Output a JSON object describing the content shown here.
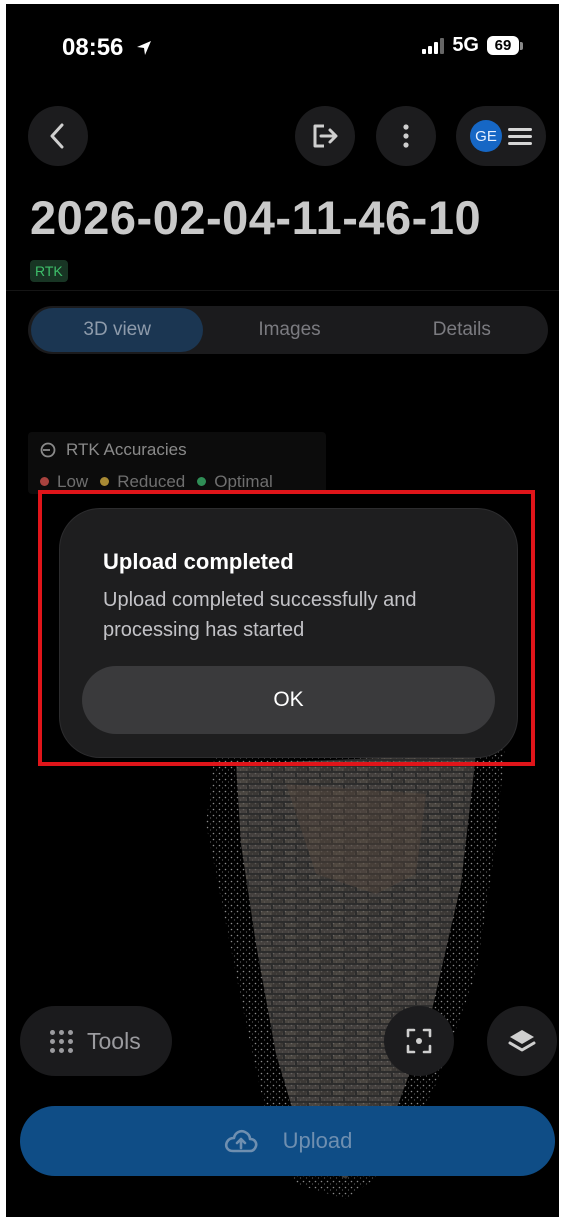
{
  "status_bar": {
    "time": "08:56",
    "network": "5G",
    "battery": "69"
  },
  "header": {
    "avatar_initials": "GE",
    "title": "2026-02-04-11-46-10",
    "badge": "RTK"
  },
  "tabs": [
    {
      "label": "3D view",
      "active": true
    },
    {
      "label": "Images",
      "active": false
    },
    {
      "label": "Details",
      "active": false
    }
  ],
  "legend": {
    "title": "RTK Accuracies",
    "items": [
      {
        "label": "Low",
        "color": "#c94a45"
      },
      {
        "label": "Reduced",
        "color": "#c9a23a"
      },
      {
        "label": "Optimal",
        "color": "#3cae68"
      }
    ]
  },
  "dialog": {
    "title": "Upload completed",
    "message": "Upload completed successfully and processing has started",
    "ok_label": "OK"
  },
  "bottom": {
    "tools_label": "Tools",
    "upload_label": "Upload"
  },
  "colors": {
    "accent": "#0f4d86",
    "highlight": "#e0151a",
    "rtk_green": "#3ebf6a"
  },
  "icons": {
    "back": "chevron-left-icon",
    "export": "export-icon",
    "more": "more-vertical-icon",
    "menu": "hamburger-icon",
    "legend": "rtk-accuracy-icon",
    "tools": "grid-dots-icon",
    "focus": "focus-frame-icon",
    "layers": "layers-icon",
    "upload": "cloud-upload-icon"
  }
}
